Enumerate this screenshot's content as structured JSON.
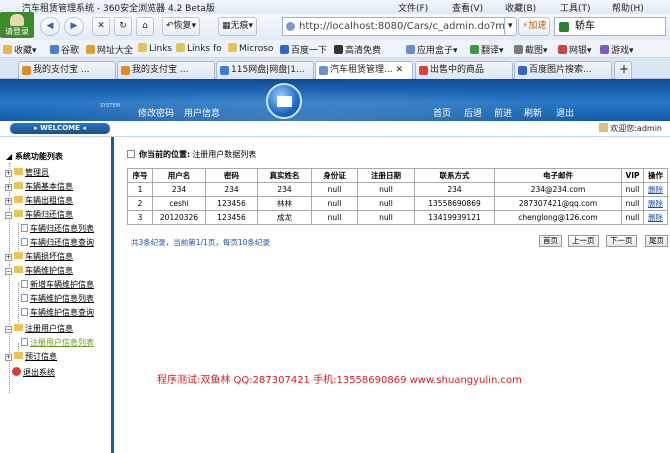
{
  "browser": {
    "title": "汽车租赁管理系统 - 360安全浏览器 4.2 Beta版",
    "menu": [
      "文件(F)",
      "查看(V)",
      "收藏(B)",
      "工具(T)",
      "帮助(H)"
    ],
    "login_label": "请登录",
    "buttons": {
      "restore": "恢复",
      "no_image": "无痕",
      "accelerate": "加速"
    },
    "address": "http://localhost:8080/Cars/c_admin.do?m",
    "search_value": "轿车",
    "favorites": [
      "收藏",
      "谷歌",
      "网址大全",
      "Links",
      "Links fo",
      "Microso",
      "百度一下",
      "高清免费",
      "应用盒子",
      "翻译",
      "截图",
      "网银",
      "游戏"
    ],
    "tabs": [
      "我的支付宝 ...",
      "我的支付宝 ...",
      "115网盘|网盘|1...",
      "汽车租赁管理...",
      "出售中的商品",
      "百度图片搜索..."
    ]
  },
  "header": {
    "tag": "SYSTEM",
    "left_links": [
      "修改密码",
      "用户信息"
    ],
    "right_links": [
      "首页",
      "后退",
      "前进",
      "刷新",
      "退出"
    ]
  },
  "subbar": {
    "welcome": "WELCOME",
    "user_text": "欢迎您:admin"
  },
  "sidebar": {
    "root": "系统功能列表",
    "items": [
      {
        "label": "管理员",
        "level": 1,
        "sel": false
      },
      {
        "label": "车辆基本信息",
        "level": 1,
        "sel": false
      },
      {
        "label": "车辆出租信息",
        "level": 1,
        "sel": false
      },
      {
        "label": "车辆归还信息",
        "level": 1,
        "sel": false
      },
      {
        "label": "车辆归还信息列表",
        "level": 2,
        "sel": false
      },
      {
        "label": "车辆归还信息查询",
        "level": 2,
        "sel": false
      },
      {
        "label": "车辆损坏信息",
        "level": 1,
        "sel": false
      },
      {
        "label": "车辆维护信息",
        "level": 1,
        "sel": false
      },
      {
        "label": "新增车辆维护信息",
        "level": 2,
        "sel": false
      },
      {
        "label": "车辆维护信息列表",
        "level": 2,
        "sel": false
      },
      {
        "label": "车辆维护信息查询",
        "level": 2,
        "sel": false
      },
      {
        "label": "注册用户信息",
        "level": 1,
        "sel": false
      },
      {
        "label": "注册用户信息列表",
        "level": 2,
        "sel": true
      },
      {
        "label": "预订信息",
        "level": 1,
        "sel": false
      },
      {
        "label": "退出系统",
        "level": 1,
        "sel": false
      }
    ]
  },
  "main": {
    "location_label": "你当前的位置:",
    "location_value": "注册用户数据列表",
    "columns": [
      "序号",
      "用户名",
      "密码",
      "真实姓名",
      "身份证",
      "注册日期",
      "联系方式",
      "电子邮件",
      "VIP",
      "操作"
    ],
    "rows": [
      [
        "1",
        "234",
        "234",
        "234",
        "null",
        "null",
        "234",
        "234@234.com",
        "null",
        "删除"
      ],
      [
        "2",
        "ceshi",
        "123456",
        "林林",
        "null",
        "null",
        "13558690869",
        "287307421@qq.com",
        "null",
        "删除"
      ],
      [
        "3",
        "20120326",
        "123456",
        "成龙",
        "null",
        "null",
        "13419939121",
        "chenglong@126.com",
        "null",
        "删除"
      ]
    ],
    "pager_text": "共3条纪录，当前第1/1页，每页10条纪录",
    "pager_buttons": [
      "首页",
      "上一页",
      "下一页",
      "尾页"
    ]
  },
  "footer_note": "程序测试:双鱼林 QQ:287307421 手机:13558690869 www.shuangyulin.com"
}
